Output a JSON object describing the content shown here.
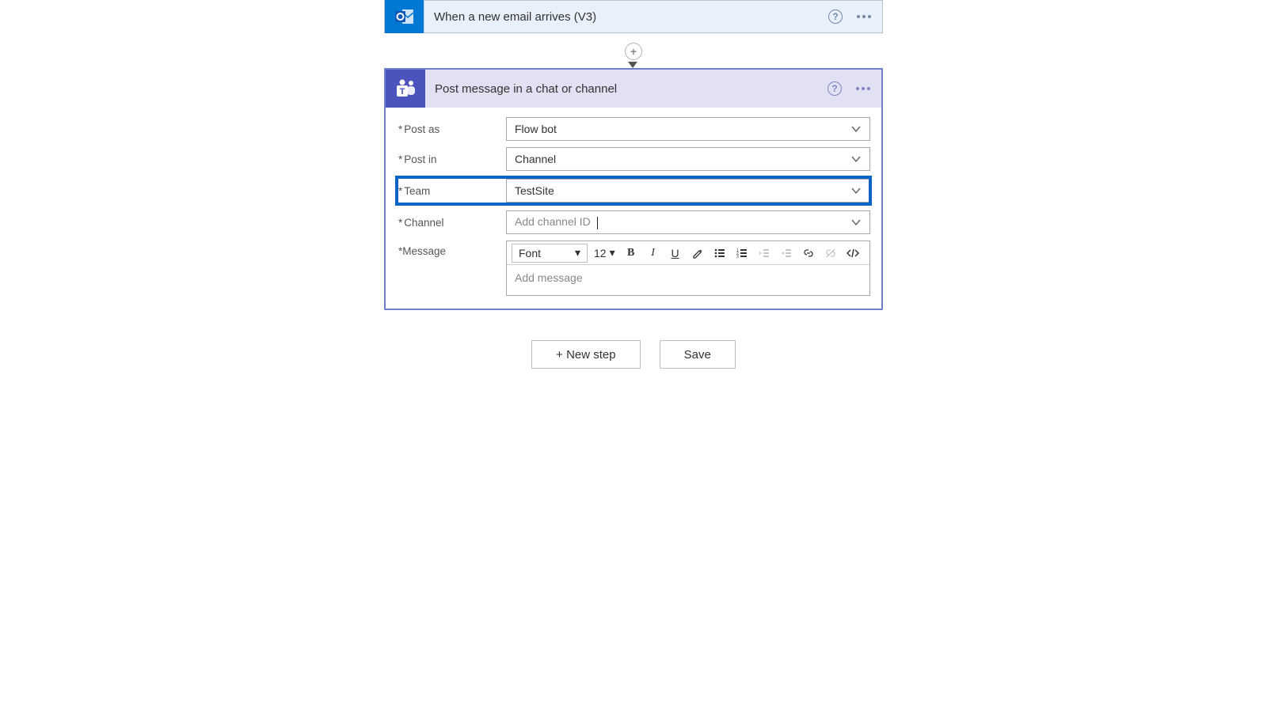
{
  "trigger": {
    "title": "When a new email arrives (V3)"
  },
  "action": {
    "title": "Post message in a chat or channel",
    "fields": {
      "post_as": {
        "label": "Post as",
        "value": "Flow bot"
      },
      "post_in": {
        "label": "Post in",
        "value": "Channel"
      },
      "team": {
        "label": "Team",
        "value": "TestSite"
      },
      "channel": {
        "label": "Channel",
        "placeholder": "Add channel ID"
      },
      "message": {
        "label": "Message",
        "placeholder": "Add message"
      }
    },
    "rte": {
      "font_label": "Font",
      "font_size": "12"
    }
  },
  "footer": {
    "new_step": "+ New step",
    "save": "Save"
  }
}
